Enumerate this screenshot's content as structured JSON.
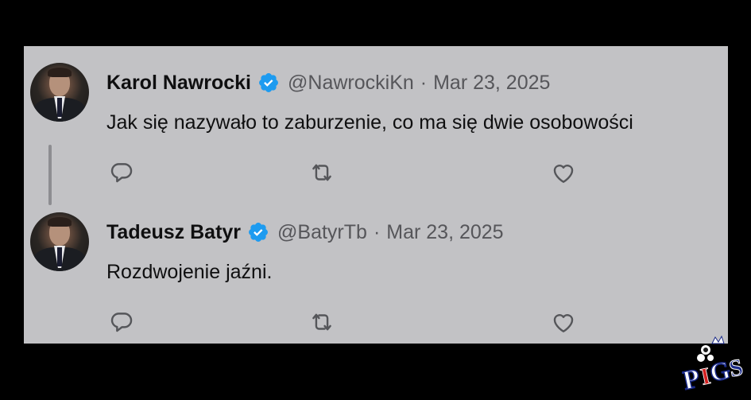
{
  "tweets": [
    {
      "author": "Karol Nawrocki",
      "handle": "@NawrockiKn",
      "separator": "·",
      "date": "Mar 23, 2025",
      "text": "Jak się nazywało to zaburzenie, co ma się dwie osobowości"
    },
    {
      "author": "Tadeusz Batyr",
      "handle": "@BatyrTb",
      "separator": "·",
      "date": "Mar 23, 2025",
      "text": "Rozdwojenie jaźni."
    }
  ],
  "icons": {
    "verified": "verified-badge-icon",
    "reply": "reply-icon",
    "retweet": "retweet-icon",
    "like": "heart-icon"
  },
  "colors": {
    "card_bg": "#c2c2c5",
    "verified": "#1d9bf0",
    "text": "#0f0f10",
    "muted": "#56565a",
    "frame_bg": "#000000"
  },
  "watermark": {
    "text": "PIGS"
  }
}
